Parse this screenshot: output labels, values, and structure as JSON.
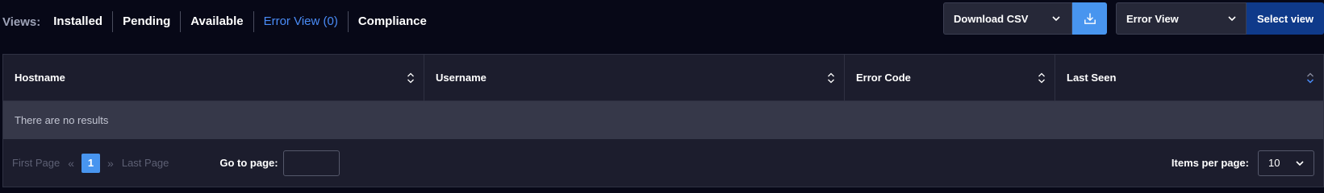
{
  "views": {
    "label": "Views:",
    "tabs": [
      {
        "label": "Installed"
      },
      {
        "label": "Pending"
      },
      {
        "label": "Available"
      },
      {
        "label": "Error View (0)",
        "active": true
      },
      {
        "label": "Compliance"
      }
    ]
  },
  "toolbar": {
    "download_label": "Download CSV",
    "download_icon": "download-icon",
    "view_select_value": "Error View",
    "select_view_label": "Select view"
  },
  "table": {
    "columns": [
      {
        "label": "Hostname",
        "sort": "both"
      },
      {
        "label": "Username",
        "sort": "both"
      },
      {
        "label": "Error Code",
        "sort": "both"
      },
      {
        "label": "Last Seen",
        "sort": "desc"
      }
    ],
    "empty_text": "There are no results"
  },
  "pagination": {
    "first_label": "First Page",
    "last_label": "Last Page",
    "current_page": "1",
    "goto_label": "Go to page:",
    "goto_value": "",
    "items_per_page_label": "Items per page:",
    "items_per_page_value": "10"
  },
  "colors": {
    "background": "#070817",
    "accent": "#4895ef",
    "active_tab": "#4a8cf7",
    "primary_button": "#0f3a8a"
  }
}
